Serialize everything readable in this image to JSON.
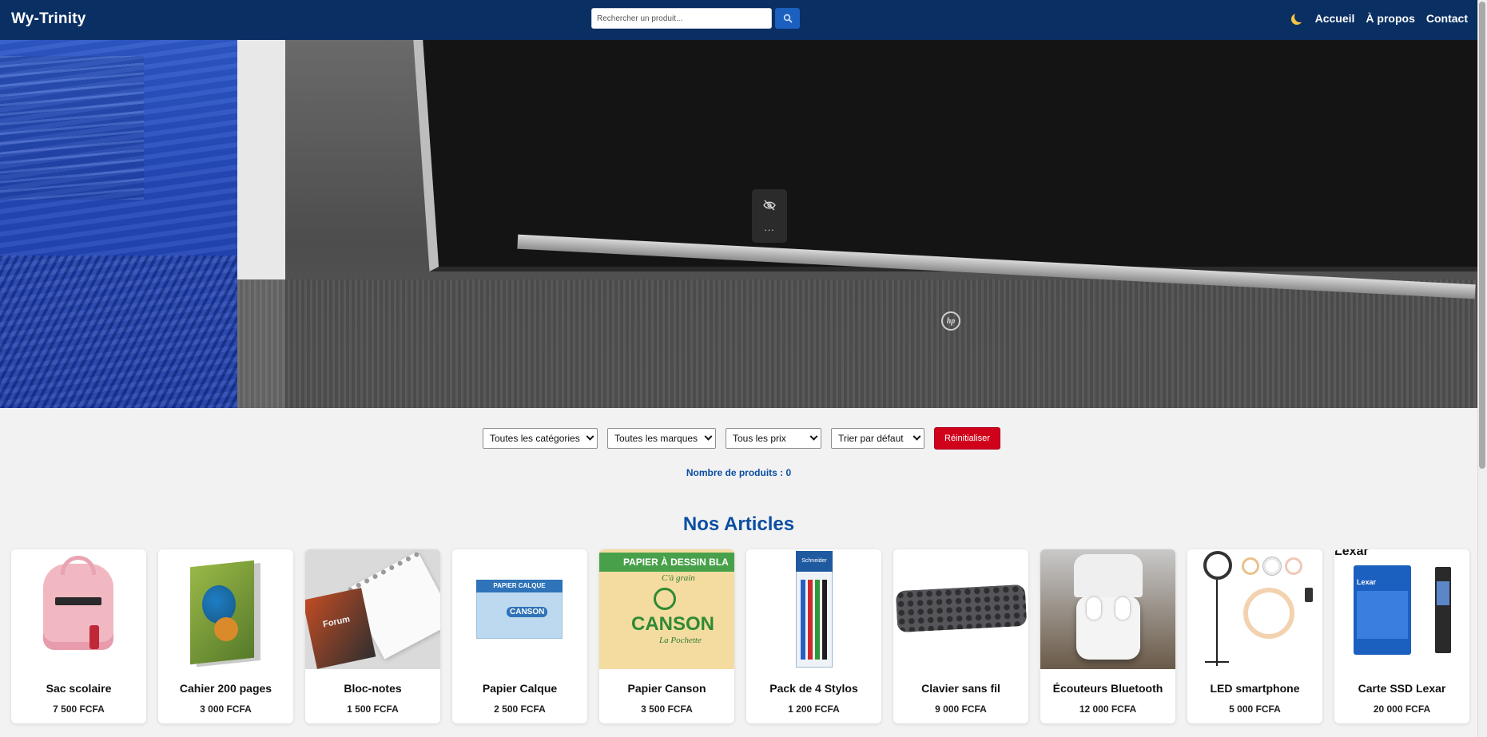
{
  "header": {
    "brand": "Wy-Trinity",
    "search_placeholder": "Rechercher un produit...",
    "search_icon": "search-icon",
    "theme_icon": "moon-icon",
    "nav": [
      "Accueil",
      "À propos",
      "Contact"
    ]
  },
  "hero": {
    "widget_icon": "eye-off-icon",
    "widget_menu": "...",
    "laptop_logo": "hp"
  },
  "filters": {
    "category": "Toutes les catégories",
    "brand": "Toutes les marques",
    "price": "Tous les prix",
    "sort": "Trier par défaut",
    "reset_label": "Réinitialiser"
  },
  "product_count": "Nombre de produits : 0",
  "section_title": "Nos Articles",
  "products": [
    {
      "name": "Sac scolaire",
      "price": "7 500 FCFA"
    },
    {
      "name": "Cahier 200 pages",
      "price": "3 000 FCFA"
    },
    {
      "name": "Bloc-notes",
      "price": "1 500 FCFA"
    },
    {
      "name": "Papier Calque",
      "price": "2 500 FCFA"
    },
    {
      "name": "Papier Canson",
      "price": "3 500 FCFA"
    },
    {
      "name": "Pack de 4 Stylos",
      "price": "1 200 FCFA"
    },
    {
      "name": "Clavier sans fil",
      "price": "9 000 FCFA"
    },
    {
      "name": "Écouteurs Bluetooth",
      "price": "12 000 FCFA"
    },
    {
      "name": "LED smartphone",
      "price": "5 000 FCFA"
    },
    {
      "name": "Carte SSD Lexar",
      "price": "20 000 FCFA"
    }
  ],
  "product_image_text": {
    "notebook": "Forum",
    "calque": "PAPIER CALQUE",
    "calque_brand": "CANSON",
    "canson_top": "PAPIER À DESSIN BLA",
    "canson_grain": "C'à grain",
    "canson_brand": "CANSON",
    "canson_sub": "La Pochette",
    "pens_brand": "Schneider",
    "ssd_brand": "Lexar",
    "ssd_corner": "Lexar"
  },
  "colors": {
    "header_bg": "#0a2f63",
    "accent_blue": "#0a4ea3",
    "reset_red": "#d0021b"
  }
}
